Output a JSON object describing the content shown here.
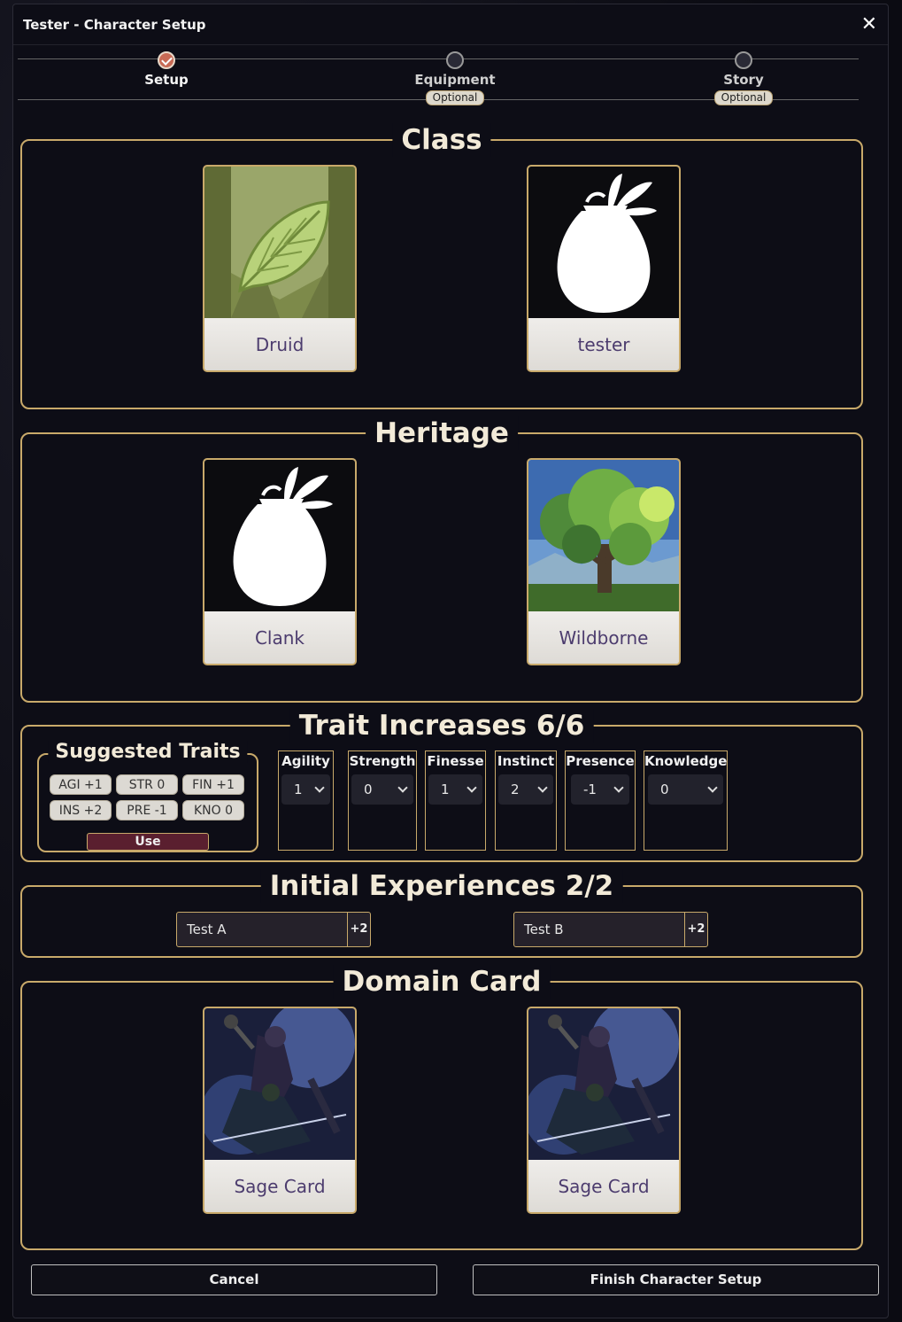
{
  "dialog": {
    "title": "Tester - Character Setup"
  },
  "progress": {
    "steps": [
      {
        "label": "Setup",
        "badge": "",
        "done": true
      },
      {
        "label": "Equipment",
        "badge": "Optional",
        "done": false
      },
      {
        "label": "Story",
        "badge": "Optional",
        "done": false
      }
    ]
  },
  "class_section": {
    "title": "Class",
    "cards": [
      {
        "name": "Druid",
        "icon": "leaf-art"
      },
      {
        "name": "tester",
        "icon": "sack-icon"
      }
    ]
  },
  "heritage_section": {
    "title": "Heritage",
    "cards": [
      {
        "name": "Clank",
        "icon": "sack-icon"
      },
      {
        "name": "Wildborne",
        "icon": "tree-art"
      }
    ]
  },
  "traits_section": {
    "title": "Trait Increases 6/6",
    "suggested": {
      "title": "Suggested Traits",
      "chips": [
        "AGI +1",
        "STR 0",
        "FIN +1",
        "INS +2",
        "PRE -1",
        "KNO 0"
      ],
      "use_label": "Use"
    },
    "traits": [
      {
        "name": "Agility",
        "value": "1"
      },
      {
        "name": "Strength",
        "value": "0"
      },
      {
        "name": "Finesse",
        "value": "1"
      },
      {
        "name": "Instinct",
        "value": "2"
      },
      {
        "name": "Presence",
        "value": "-1"
      },
      {
        "name": "Knowledge",
        "value": "0"
      }
    ]
  },
  "experiences_section": {
    "title": "Initial Experiences 2/2",
    "items": [
      {
        "name": "Test A",
        "bonus": "+2"
      },
      {
        "name": "Test B",
        "bonus": "+2"
      }
    ]
  },
  "domain_section": {
    "title": "Domain Card",
    "cards": [
      {
        "name": "Sage Card",
        "icon": "warrior-art"
      },
      {
        "name": "Sage Card",
        "icon": "warrior-art"
      }
    ]
  },
  "footer": {
    "cancel_label": "Cancel",
    "finish_label": "Finish Character Setup"
  },
  "colors": {
    "accent_gold": "#c8a96a",
    "done_step": "#c86a55",
    "use_button": "#5a1f2f"
  }
}
